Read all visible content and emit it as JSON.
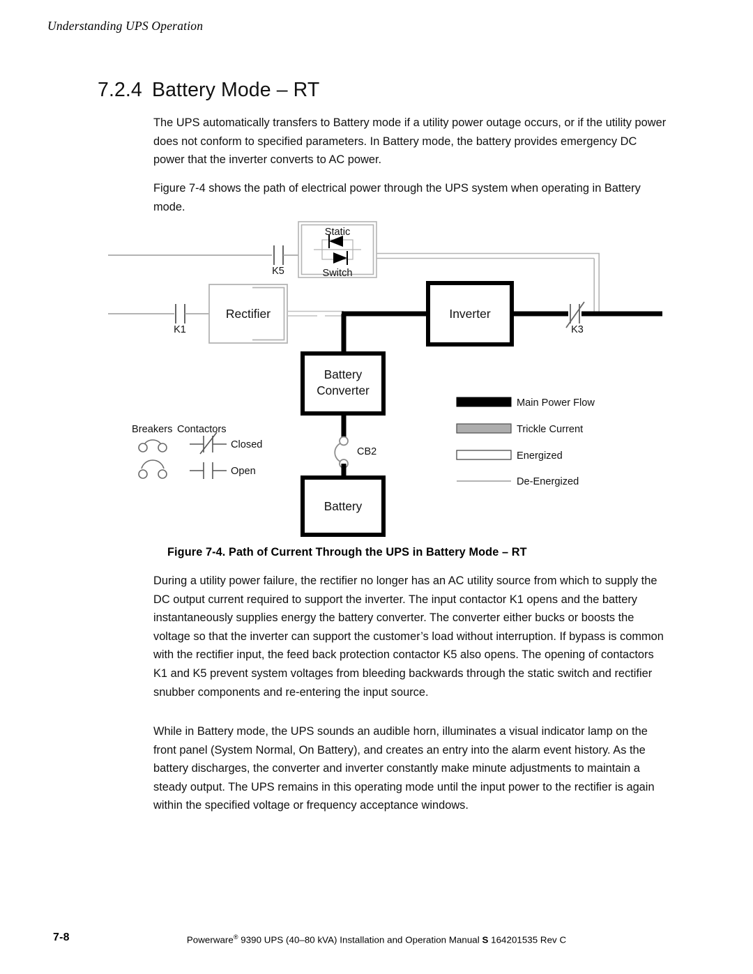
{
  "header": {
    "running_title": "Understanding UPS Operation"
  },
  "section": {
    "number": "7.2.4",
    "title": "Battery Mode – RT"
  },
  "body": {
    "para_intro": "The UPS automatically transfers to Battery mode if a utility power outage occurs, or if the utility power does not conform to specified parameters. In Battery mode, the battery provides emergency DC power that the inverter converts to AC power.",
    "para_figref": "Figure 7-4 shows the path of electrical power through the UPS system when operating in Battery mode.",
    "para_after_figure": "During a utility power failure, the rectifier no longer has an AC utility source from which to supply the DC output current required to support the inverter. The input contactor K1 opens and the battery instantaneously supplies energy the battery converter. The converter either bucks or boosts the voltage so that the inverter can support the customer’s load without interruption. If bypass is common with the rectifier input, the feed back protection contactor K5 also opens. The opening of contactors K1 and K5 prevent system voltages from bleeding backwards through the static switch and rectifier snubber components and re-entering the input source.",
    "para_while_battery": "While in Battery mode, the UPS sounds an audible horn, illuminates a visual indicator lamp on the front panel (System Normal, On Battery), and creates an entry into the alarm event history. As the battery discharges, the converter and inverter constantly make minute adjustments to maintain a steady output. The UPS remains in this operating mode until the input power to the rectifier is again within the specified voltage or frequency acceptance windows."
  },
  "figure": {
    "caption": "Figure 7-4. Path of Current Through the UPS in Battery Mode – RT",
    "blocks": {
      "static_switch_top": "Static",
      "static_switch_bottom": "Switch",
      "rectifier": "Rectifier",
      "inverter": "Inverter",
      "battery_converter_line1": "Battery",
      "battery_converter_line2": "Converter",
      "battery": "Battery"
    },
    "labels": {
      "k5": "K5",
      "k1": "K1",
      "k3": "K3",
      "cb2": "CB2"
    },
    "key": {
      "breakers_heading": "Breakers",
      "contactors_heading": "Contactors",
      "closed": "Closed",
      "open": "Open"
    },
    "legend": [
      {
        "label": "Main Power Flow",
        "style": "solid-black-bar",
        "color": "#000000"
      },
      {
        "label": "Trickle Current",
        "style": "gray-filled-bar",
        "color": "#adadad"
      },
      {
        "label": "Energized",
        "style": "white-outlined-bar",
        "color": "#ffffff"
      },
      {
        "label": "De-Energized",
        "style": "thin-gray-line",
        "color": "#9a9a9a"
      }
    ]
  },
  "footer": {
    "page_number": "7-8",
    "manual_prefix": "Powerware",
    "manual_rest": " 9390 UPS (40–80 kVA) Installation and Operation Manual ",
    "manual_mark": "S",
    "manual_docnum": " 164201535 Rev C"
  }
}
